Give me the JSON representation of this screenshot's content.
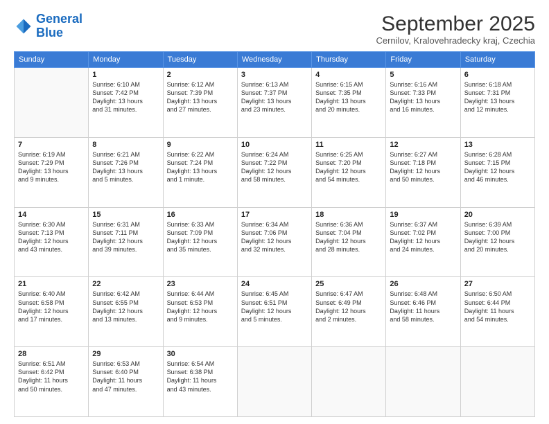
{
  "logo": {
    "line1": "General",
    "line2": "Blue"
  },
  "title": "September 2025",
  "location": "Cernilov, Kralovehradecky kraj, Czechia",
  "days_of_week": [
    "Sunday",
    "Monday",
    "Tuesday",
    "Wednesday",
    "Thursday",
    "Friday",
    "Saturday"
  ],
  "weeks": [
    [
      {
        "day": "",
        "info": ""
      },
      {
        "day": "1",
        "info": "Sunrise: 6:10 AM\nSunset: 7:42 PM\nDaylight: 13 hours\nand 31 minutes."
      },
      {
        "day": "2",
        "info": "Sunrise: 6:12 AM\nSunset: 7:39 PM\nDaylight: 13 hours\nand 27 minutes."
      },
      {
        "day": "3",
        "info": "Sunrise: 6:13 AM\nSunset: 7:37 PM\nDaylight: 13 hours\nand 23 minutes."
      },
      {
        "day": "4",
        "info": "Sunrise: 6:15 AM\nSunset: 7:35 PM\nDaylight: 13 hours\nand 20 minutes."
      },
      {
        "day": "5",
        "info": "Sunrise: 6:16 AM\nSunset: 7:33 PM\nDaylight: 13 hours\nand 16 minutes."
      },
      {
        "day": "6",
        "info": "Sunrise: 6:18 AM\nSunset: 7:31 PM\nDaylight: 13 hours\nand 12 minutes."
      }
    ],
    [
      {
        "day": "7",
        "info": "Sunrise: 6:19 AM\nSunset: 7:29 PM\nDaylight: 13 hours\nand 9 minutes."
      },
      {
        "day": "8",
        "info": "Sunrise: 6:21 AM\nSunset: 7:26 PM\nDaylight: 13 hours\nand 5 minutes."
      },
      {
        "day": "9",
        "info": "Sunrise: 6:22 AM\nSunset: 7:24 PM\nDaylight: 13 hours\nand 1 minute."
      },
      {
        "day": "10",
        "info": "Sunrise: 6:24 AM\nSunset: 7:22 PM\nDaylight: 12 hours\nand 58 minutes."
      },
      {
        "day": "11",
        "info": "Sunrise: 6:25 AM\nSunset: 7:20 PM\nDaylight: 12 hours\nand 54 minutes."
      },
      {
        "day": "12",
        "info": "Sunrise: 6:27 AM\nSunset: 7:18 PM\nDaylight: 12 hours\nand 50 minutes."
      },
      {
        "day": "13",
        "info": "Sunrise: 6:28 AM\nSunset: 7:15 PM\nDaylight: 12 hours\nand 46 minutes."
      }
    ],
    [
      {
        "day": "14",
        "info": "Sunrise: 6:30 AM\nSunset: 7:13 PM\nDaylight: 12 hours\nand 43 minutes."
      },
      {
        "day": "15",
        "info": "Sunrise: 6:31 AM\nSunset: 7:11 PM\nDaylight: 12 hours\nand 39 minutes."
      },
      {
        "day": "16",
        "info": "Sunrise: 6:33 AM\nSunset: 7:09 PM\nDaylight: 12 hours\nand 35 minutes."
      },
      {
        "day": "17",
        "info": "Sunrise: 6:34 AM\nSunset: 7:06 PM\nDaylight: 12 hours\nand 32 minutes."
      },
      {
        "day": "18",
        "info": "Sunrise: 6:36 AM\nSunset: 7:04 PM\nDaylight: 12 hours\nand 28 minutes."
      },
      {
        "day": "19",
        "info": "Sunrise: 6:37 AM\nSunset: 7:02 PM\nDaylight: 12 hours\nand 24 minutes."
      },
      {
        "day": "20",
        "info": "Sunrise: 6:39 AM\nSunset: 7:00 PM\nDaylight: 12 hours\nand 20 minutes."
      }
    ],
    [
      {
        "day": "21",
        "info": "Sunrise: 6:40 AM\nSunset: 6:58 PM\nDaylight: 12 hours\nand 17 minutes."
      },
      {
        "day": "22",
        "info": "Sunrise: 6:42 AM\nSunset: 6:55 PM\nDaylight: 12 hours\nand 13 minutes."
      },
      {
        "day": "23",
        "info": "Sunrise: 6:44 AM\nSunset: 6:53 PM\nDaylight: 12 hours\nand 9 minutes."
      },
      {
        "day": "24",
        "info": "Sunrise: 6:45 AM\nSunset: 6:51 PM\nDaylight: 12 hours\nand 5 minutes."
      },
      {
        "day": "25",
        "info": "Sunrise: 6:47 AM\nSunset: 6:49 PM\nDaylight: 12 hours\nand 2 minutes."
      },
      {
        "day": "26",
        "info": "Sunrise: 6:48 AM\nSunset: 6:46 PM\nDaylight: 11 hours\nand 58 minutes."
      },
      {
        "day": "27",
        "info": "Sunrise: 6:50 AM\nSunset: 6:44 PM\nDaylight: 11 hours\nand 54 minutes."
      }
    ],
    [
      {
        "day": "28",
        "info": "Sunrise: 6:51 AM\nSunset: 6:42 PM\nDaylight: 11 hours\nand 50 minutes."
      },
      {
        "day": "29",
        "info": "Sunrise: 6:53 AM\nSunset: 6:40 PM\nDaylight: 11 hours\nand 47 minutes."
      },
      {
        "day": "30",
        "info": "Sunrise: 6:54 AM\nSunset: 6:38 PM\nDaylight: 11 hours\nand 43 minutes."
      },
      {
        "day": "",
        "info": ""
      },
      {
        "day": "",
        "info": ""
      },
      {
        "day": "",
        "info": ""
      },
      {
        "day": "",
        "info": ""
      }
    ]
  ]
}
